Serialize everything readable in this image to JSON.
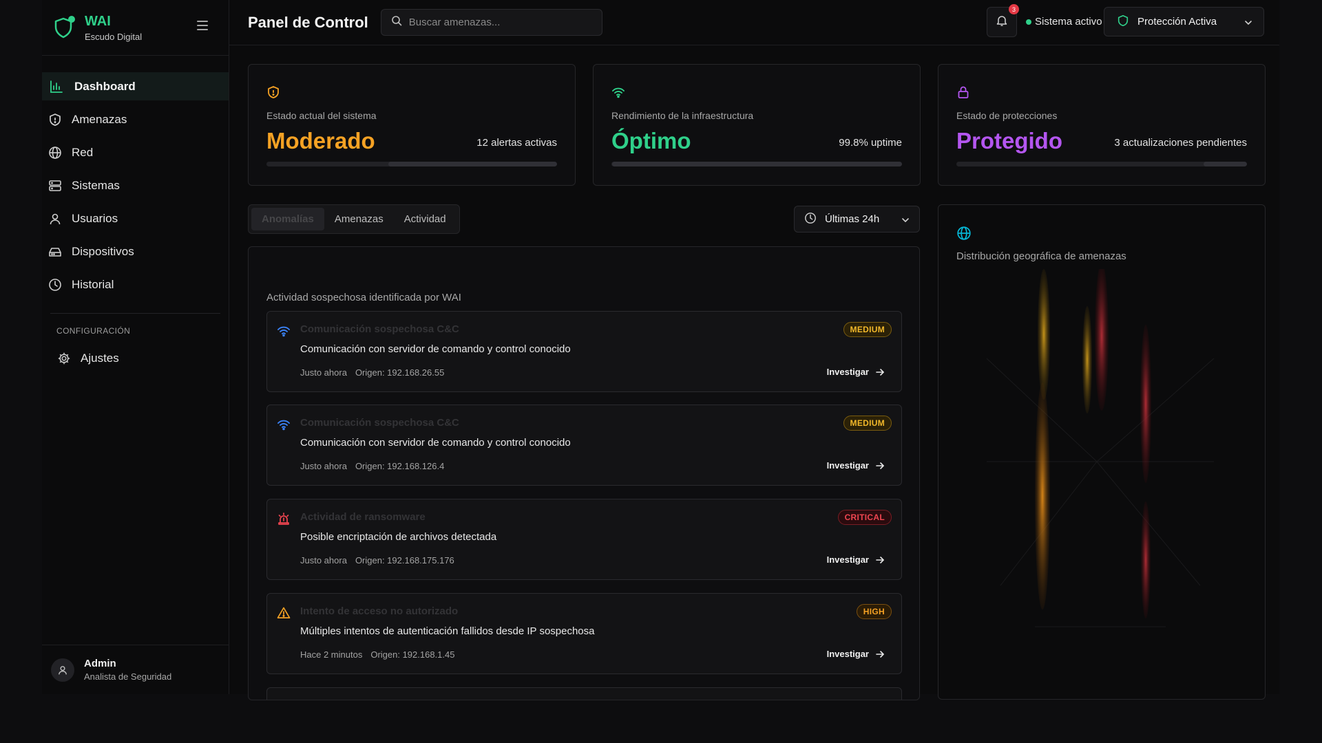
{
  "brand": {
    "name": "WAI",
    "subtitle": "Escudo Digital"
  },
  "sidebar": {
    "items": [
      {
        "label": "Dashboard",
        "icon": "bar-chart-icon",
        "active": true
      },
      {
        "label": "Amenazas",
        "icon": "shield-icon"
      },
      {
        "label": "Red",
        "icon": "globe-icon"
      },
      {
        "label": "Sistemas",
        "icon": "server-icon"
      },
      {
        "label": "Usuarios",
        "icon": "user-icon"
      },
      {
        "label": "Dispositivos",
        "icon": "hard-drive-icon"
      },
      {
        "label": "Historial",
        "icon": "clock-icon"
      }
    ],
    "config_label": "CONFIGURACIÓN",
    "settings_label": "Ajustes"
  },
  "user": {
    "name": "Admin",
    "role": "Analista de Seguridad"
  },
  "topbar": {
    "title": "Panel de Control",
    "search_placeholder": "Buscar amenazas...",
    "notifications_count": "3",
    "system_status": "Sistema activo",
    "protection_label": "Protección Activa"
  },
  "stats": [
    {
      "label": "Estado actual del sistema",
      "value": "Moderado",
      "side": "12 alertas activas",
      "color": "#f6a224",
      "progress": 0.58
    },
    {
      "label": "Rendimiento de la infraestructura",
      "value": "Óptimo",
      "side": "99.8% uptime",
      "color": "#2fd08a",
      "progress": 0.998
    },
    {
      "label": "Estado de protecciones",
      "value": "Protegido",
      "side": "3 actualizaciones pendientes",
      "color": "#b456f0",
      "progress": 0.15
    }
  ],
  "tabs": [
    "Anomalías",
    "Amenazas",
    "Actividad"
  ],
  "time_range": "Últimas 24h",
  "feed": {
    "title": "Actividad sospechosa identificada por WAI",
    "investigate_label": "Investigar",
    "alerts": [
      {
        "title": "Comunicación sospechosa C&C",
        "description": "Comunicación con servidor de comando y control conocido",
        "time": "Justo ahora",
        "origin": "Origen: 192.168.26.55",
        "severity": "MEDIUM",
        "icon": "wifi-icon"
      },
      {
        "title": "Comunicación sospechosa C&C",
        "description": "Comunicación con servidor de comando y control conocido",
        "time": "Justo ahora",
        "origin": "Origen: 192.168.126.4",
        "severity": "MEDIUM",
        "icon": "wifi-icon"
      },
      {
        "title": "Actividad de ransomware",
        "description": "Posible encriptación de archivos detectada",
        "time": "Justo ahora",
        "origin": "Origen: 192.168.175.176",
        "severity": "CRITICAL",
        "icon": "siren-icon"
      },
      {
        "title": "Intento de acceso no autorizado",
        "description": "Múltiples intentos de autenticación fallidos desde IP sospechosa",
        "time": "Hace 2 minutos",
        "origin": "Origen: 192.168.1.45",
        "severity": "HIGH",
        "icon": "warning-icon"
      }
    ]
  },
  "geo": {
    "title": "Distribución geográfica de amenazas"
  },
  "colors": {
    "accent": "#2fd08a",
    "medium": "#f2b82a",
    "critical": "#ee4550",
    "high": "#f6a224",
    "info": "#3b82f6",
    "geo": "#06b6d4"
  }
}
